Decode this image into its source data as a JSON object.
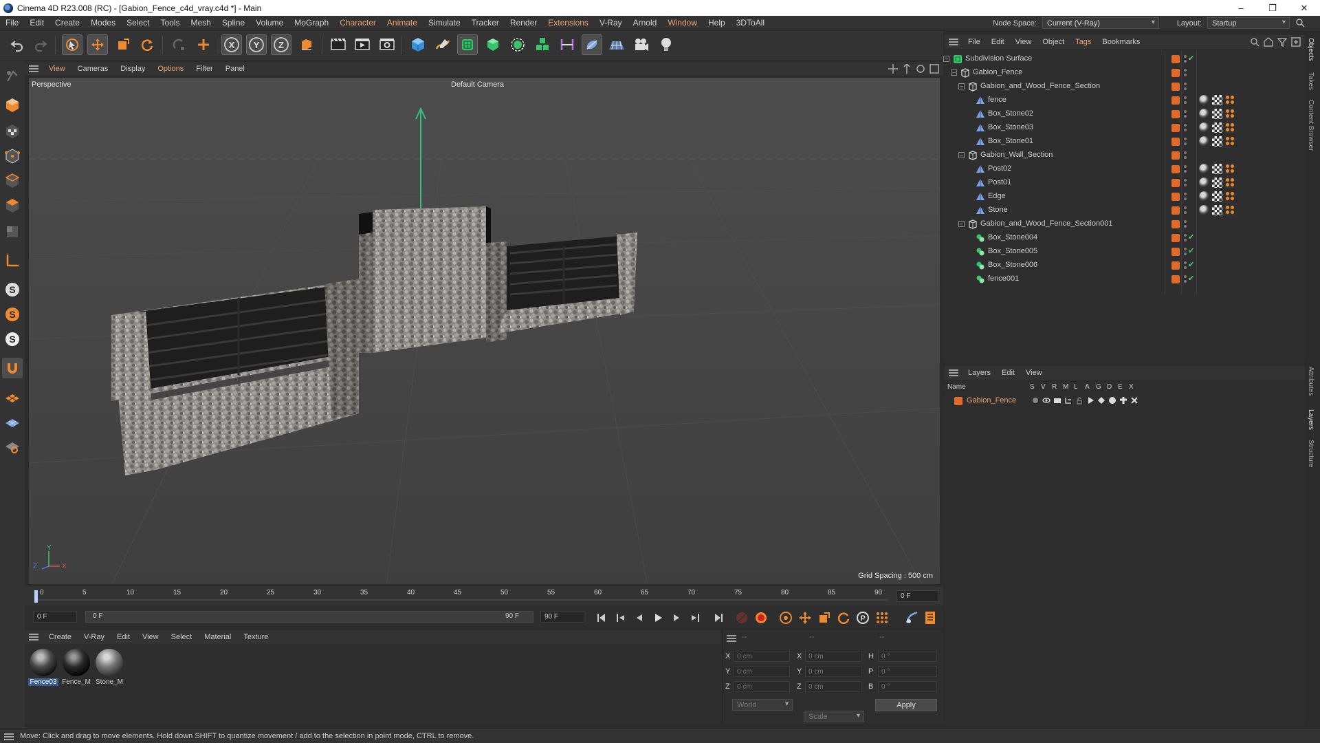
{
  "window": {
    "title": "Cinema 4D R23.008 (RC) - [Gabion_Fence_c4d_vray.c4d *] - Main",
    "controls": [
      "–",
      "❐",
      "✕"
    ]
  },
  "menubar": {
    "items": [
      "File",
      "Edit",
      "Create",
      "Modes",
      "Select",
      "Tools",
      "Mesh",
      "Spline",
      "Volume",
      "MoGraph",
      "Character",
      "Animate",
      "Simulate",
      "Tracker",
      "Render",
      "Extensions",
      "V-Ray",
      "Arnold",
      "Window",
      "Help",
      "3DToAll"
    ],
    "node_space_label": "Node Space:",
    "node_space_value": "Current (V-Ray)",
    "layout_label": "Layout:",
    "layout_value": "Startup"
  },
  "viewport": {
    "menu": [
      "View",
      "Cameras",
      "Display",
      "Options",
      "Filter",
      "Panel"
    ],
    "view_name": "Perspective",
    "camera": "Default Camera",
    "grid_spacing": "Grid Spacing : 500 cm",
    "axis_labels": [
      "Y",
      "Z",
      "X"
    ]
  },
  "timeline": {
    "ticks": [
      "0",
      "5",
      "10",
      "15",
      "20",
      "25",
      "30",
      "35",
      "40",
      "45",
      "50",
      "55",
      "60",
      "65",
      "70",
      "75",
      "80",
      "85",
      "90"
    ],
    "current_frame_right": "0 F",
    "start_field": "0 F",
    "range_start": "0 F",
    "range_end": "90 F",
    "end_field": "90 F"
  },
  "material_manager": {
    "menu": [
      "Create",
      "V-Ray",
      "Edit",
      "View",
      "Select",
      "Material",
      "Texture"
    ],
    "materials": [
      {
        "name": "Fence03",
        "selected": true
      },
      {
        "name": "Fence_M",
        "selected": false
      },
      {
        "name": "Stone_M",
        "selected": false
      }
    ]
  },
  "coordinates": {
    "header": [
      "--",
      "--",
      "--"
    ],
    "rows": [
      {
        "a": "X",
        "av": "0 cm",
        "b": "X",
        "bv": "0 cm",
        "c": "H",
        "cv": "0 °"
      },
      {
        "a": "Y",
        "av": "0 cm",
        "b": "Y",
        "bv": "0 cm",
        "c": "P",
        "cv": "0 °"
      },
      {
        "a": "Z",
        "av": "0 cm",
        "b": "Z",
        "bv": "0 cm",
        "c": "B",
        "cv": "0 °"
      }
    ],
    "space": "World",
    "mode": "Scale",
    "apply_label": "Apply"
  },
  "object_manager": {
    "menu": [
      "File",
      "Edit",
      "View",
      "Object",
      "Tags",
      "Bookmarks"
    ],
    "objects": [
      {
        "name": "Subdivision Surface",
        "indent": 0,
        "expander": "–",
        "icon": "subdiv",
        "check": true,
        "tags": false
      },
      {
        "name": "Gabion_Fence",
        "indent": 1,
        "expander": "–",
        "icon": "null",
        "check": false,
        "tags": false
      },
      {
        "name": "Gabion_and_Wood_Fence_Section",
        "indent": 2,
        "expander": "–",
        "icon": "null",
        "check": false,
        "tags": false
      },
      {
        "name": "fence",
        "indent": 3,
        "expander": "",
        "icon": "poly",
        "check": false,
        "tags": true
      },
      {
        "name": "Box_Stone02",
        "indent": 3,
        "expander": "",
        "icon": "poly",
        "check": false,
        "tags": true
      },
      {
        "name": "Box_Stone03",
        "indent": 3,
        "expander": "",
        "icon": "poly",
        "check": false,
        "tags": true
      },
      {
        "name": "Box_Stone01",
        "indent": 3,
        "expander": "",
        "icon": "poly",
        "check": false,
        "tags": true
      },
      {
        "name": "Gabion_Wall_Section",
        "indent": 2,
        "expander": "–",
        "icon": "null",
        "check": false,
        "tags": false
      },
      {
        "name": "Post02",
        "indent": 3,
        "expander": "",
        "icon": "poly",
        "check": false,
        "tags": true
      },
      {
        "name": "Post01",
        "indent": 3,
        "expander": "",
        "icon": "poly",
        "check": false,
        "tags": true
      },
      {
        "name": "Edge",
        "indent": 3,
        "expander": "",
        "icon": "poly",
        "check": false,
        "tags": true
      },
      {
        "name": "Stone",
        "indent": 3,
        "expander": "",
        "icon": "poly",
        "check": false,
        "tags": true
      },
      {
        "name": "Gabion_and_Wood_Fence_Section001",
        "indent": 2,
        "expander": "–",
        "icon": "null",
        "check": false,
        "tags": false
      },
      {
        "name": "Box_Stone004",
        "indent": 3,
        "expander": "",
        "icon": "instance",
        "check": true,
        "tags": false
      },
      {
        "name": "Box_Stone005",
        "indent": 3,
        "expander": "",
        "icon": "instance",
        "check": true,
        "tags": false
      },
      {
        "name": "Box_Stone006",
        "indent": 3,
        "expander": "",
        "icon": "instance",
        "check": true,
        "tags": false
      },
      {
        "name": "fence001",
        "indent": 3,
        "expander": "",
        "icon": "instance",
        "check": true,
        "tags": false
      }
    ]
  },
  "layer_manager": {
    "menu": [
      "Layers",
      "Edit",
      "View"
    ],
    "columns": [
      "Name",
      "S",
      "V",
      "R",
      "M",
      "L",
      "A",
      "G",
      "D",
      "E",
      "X"
    ],
    "layers": [
      {
        "name": "Gabion_Fence",
        "color": "#e06a2a"
      }
    ]
  },
  "edge_tabs": [
    "Objects",
    "Takes",
    "Content Browser",
    "Attributes",
    "Layers",
    "Structure"
  ],
  "status": "Move: Click and drag to move elements. Hold down SHIFT to quantize movement / add to the selection in point mode, CTRL to remove.",
  "colors": {
    "accent": "#f0a36c",
    "layer": "#e06a2a",
    "check": "#4cd36b",
    "panel": "#333333"
  }
}
